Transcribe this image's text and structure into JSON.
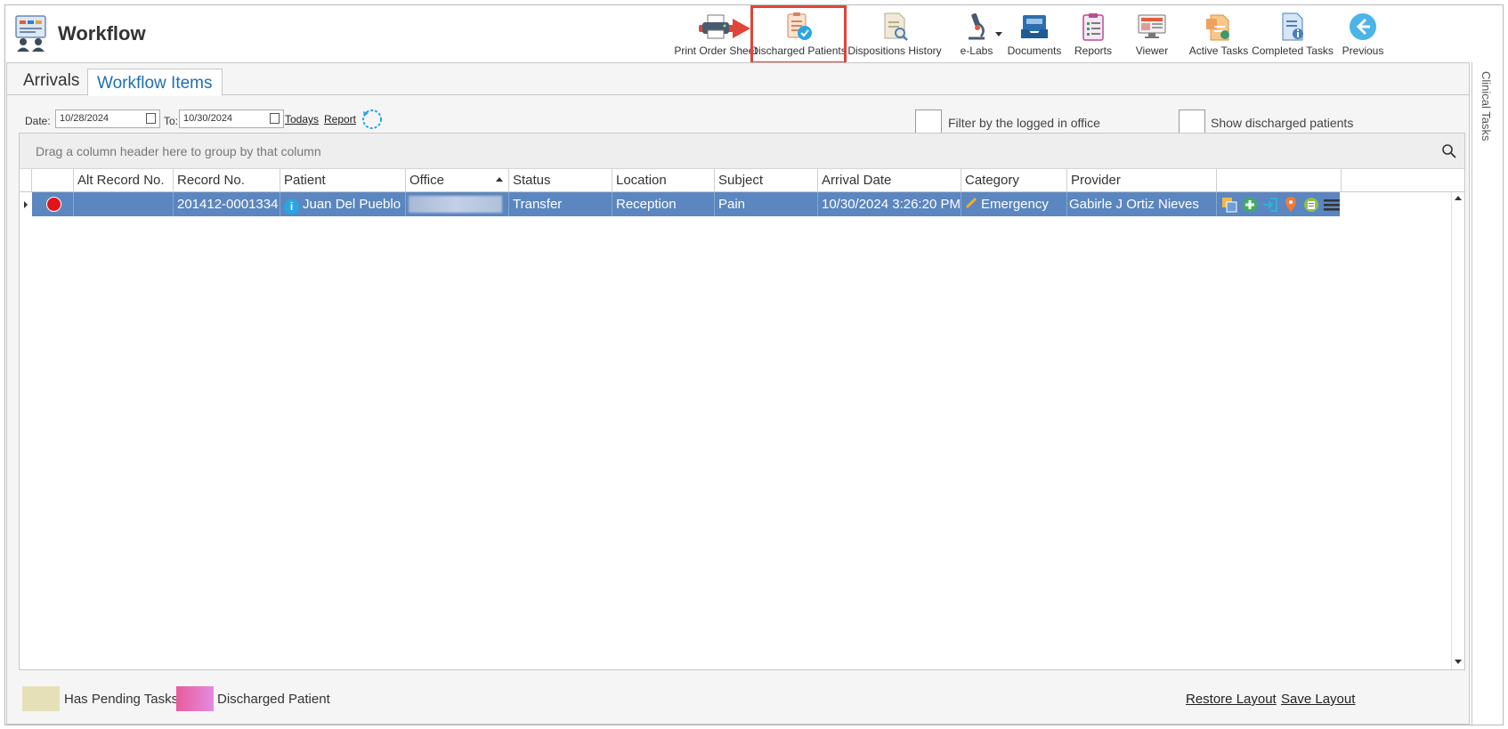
{
  "app": {
    "title": "Workflow",
    "icon": "workflow-app-icon"
  },
  "toolbar": {
    "buttons": [
      {
        "label": "Print Order Sheet",
        "icon": "print-order-sheet-icon"
      },
      {
        "label": "Discharged Patients",
        "icon": "discharged-patients-icon",
        "highlighted": true
      },
      {
        "label": "Dispositions History",
        "icon": "dispositions-history-icon"
      },
      {
        "label": "e-Labs",
        "icon": "microscope-icon"
      },
      {
        "label": "Documents",
        "icon": "documents-tray-icon"
      },
      {
        "label": "Reports",
        "icon": "reports-clipboard-icon"
      },
      {
        "label": "Viewer",
        "icon": "viewer-monitor-icon"
      },
      {
        "label": "Active Tasks",
        "icon": "active-tasks-icon"
      },
      {
        "label": "Completed Tasks",
        "icon": "completed-tasks-icon"
      },
      {
        "label": "Previous",
        "icon": "previous-arrow-icon"
      }
    ],
    "highlight_color": "#e0453a"
  },
  "side_tab": {
    "label": "Clinical Tasks"
  },
  "tabs": [
    {
      "label": "Arrivals",
      "active": false
    },
    {
      "label": "Workflow Items",
      "active": true
    }
  ],
  "filters": {
    "date_label": "Date:",
    "date_from": "10/28/2024",
    "to_label": "To:",
    "date_to": "10/30/2024",
    "todays_link": "Todays",
    "report_link": "Report",
    "filter_office_label": "Filter by the logged in office",
    "filter_office_checked": false,
    "show_discharged_label": "Show discharged patients",
    "show_discharged_checked": false
  },
  "grid": {
    "group_hint": "Drag a column header here to group by that column",
    "columns": [
      "Alt Record No.",
      "Record No.",
      "Patient",
      "Office",
      "Status",
      "Location",
      "Subject",
      "Arrival Date",
      "Category",
      "Provider"
    ],
    "sorted_column": "Office",
    "sort_direction": "ascending",
    "rows": [
      {
        "alt_record_no": "",
        "record_no": "201412-0001334",
        "patient": "Juan Del Pueblo",
        "office": "",
        "status": "Transfer",
        "location": "Reception",
        "subject": "Pain",
        "arrival_date": "10/30/2024 3:26:20 PM",
        "category": "Emergency",
        "provider": "Gabirle J Ortiz Nieves",
        "status_dot_color": "#e0141a",
        "selected": true
      }
    ],
    "selected_row_color": "#5b86bf",
    "row_actions": [
      "copy-icon",
      "add-icon",
      "sign-in-icon",
      "location-pin-icon",
      "note-icon",
      "menu-icon"
    ]
  },
  "legend": {
    "pending_label": "Has Pending Tasks",
    "pending_color": "#e6e0b8",
    "discharged_label": "Discharged Patient",
    "discharged_color": "#e96fa8",
    "restore_layout": "Restore Layout",
    "save_layout": "Save Layout"
  }
}
